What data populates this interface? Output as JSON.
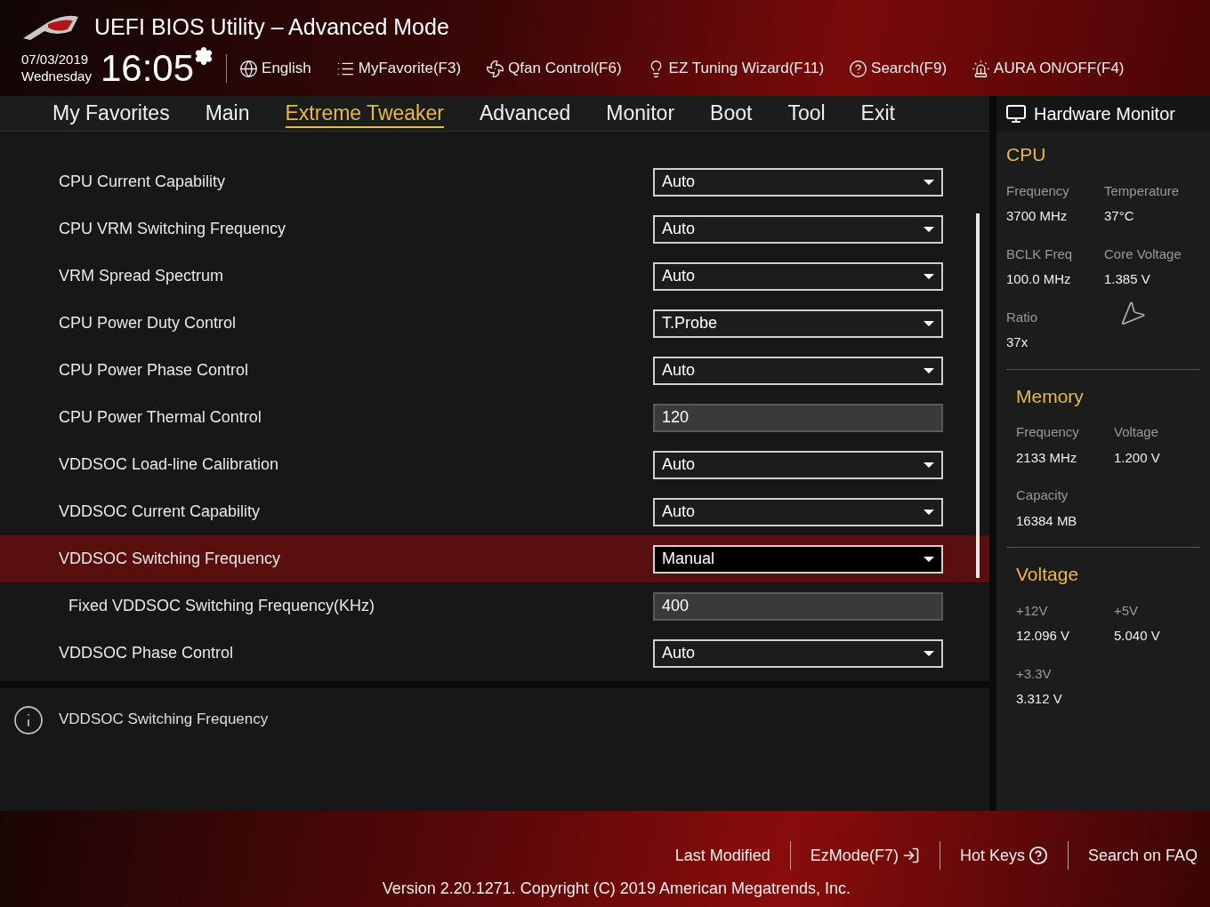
{
  "header": {
    "title": "UEFI BIOS Utility – Advanced Mode",
    "date": "07/03/2019",
    "day": "Wednesday",
    "time": "16:05",
    "tools": [
      "English",
      "MyFavorite(F3)",
      "Qfan Control(F6)",
      "EZ Tuning Wizard(F11)",
      "Search(F9)",
      "AURA ON/OFF(F4)"
    ]
  },
  "tabs": [
    {
      "label": "My Favorites",
      "selected": false
    },
    {
      "label": "Main",
      "selected": false
    },
    {
      "label": "Extreme Tweaker",
      "selected": true
    },
    {
      "label": "Advanced",
      "selected": false
    },
    {
      "label": "Monitor",
      "selected": false
    },
    {
      "label": "Boot",
      "selected": false
    },
    {
      "label": "Tool",
      "selected": false
    },
    {
      "label": "Exit",
      "selected": false
    }
  ],
  "settings": [
    {
      "label": "CPU Current Capability",
      "value": "Auto",
      "kind": "dropdown",
      "selected": false
    },
    {
      "label": "CPU VRM Switching Frequency",
      "value": "Auto",
      "kind": "dropdown",
      "selected": false
    },
    {
      "label": "VRM Spread Spectrum",
      "value": "Auto",
      "kind": "dropdown",
      "selected": false
    },
    {
      "label": "CPU Power Duty Control",
      "value": "T.Probe",
      "kind": "dropdown",
      "selected": false
    },
    {
      "label": "CPU Power Phase Control",
      "value": "Auto",
      "kind": "dropdown",
      "selected": false
    },
    {
      "label": "CPU Power Thermal Control",
      "value": "120",
      "kind": "number",
      "selected": false
    },
    {
      "label": "VDDSOC Load-line Calibration",
      "value": "Auto",
      "kind": "dropdown",
      "selected": false
    },
    {
      "label": "VDDSOC Current Capability",
      "value": "Auto",
      "kind": "dropdown",
      "selected": false
    },
    {
      "label": "VDDSOC Switching Frequency",
      "value": "Manual",
      "kind": "dropdown",
      "selected": true,
      "children": [
        {
          "label": "Fixed VDDSOC Switching Frequency(KHz)",
          "value": "400",
          "kind": "number",
          "selected": false
        }
      ]
    },
    {
      "label": "VDDSOC Phase Control",
      "value": "Auto",
      "kind": "dropdown",
      "selected": false
    }
  ],
  "help": {
    "text": "VDDSOC Switching Frequency"
  },
  "hardware_monitor": {
    "title": "Hardware Monitor",
    "sections": [
      {
        "title": "CPU",
        "items": [
          {
            "label": "Frequency",
            "value": "3700 MHz"
          },
          {
            "label": "Temperature",
            "value": "37°C"
          },
          {
            "label": "BCLK Freq",
            "value": "100.0 MHz"
          },
          {
            "label": "Core Voltage",
            "value": "1.385 V"
          },
          {
            "label": "Ratio",
            "value": "37x"
          }
        ]
      },
      {
        "title": "Memory",
        "items": [
          {
            "label": "Frequency",
            "value": "2133 MHz"
          },
          {
            "label": "Voltage",
            "value": "1.200 V"
          },
          {
            "label": "Capacity",
            "value": "16384 MB"
          }
        ]
      },
      {
        "title": "Voltage",
        "items": [
          {
            "label": "+12V",
            "value": "12.096 V"
          },
          {
            "label": "+5V",
            "value": "5.040 V"
          },
          {
            "label": "+3.3V",
            "value": "3.312 V"
          }
        ]
      }
    ]
  },
  "footer": {
    "links": [
      "Last Modified",
      "EzMode(F7)",
      "Hot Keys",
      "Search on FAQ"
    ],
    "version": "Version 2.20.1271. Copyright (C) 2019 American Megatrends, Inc."
  }
}
